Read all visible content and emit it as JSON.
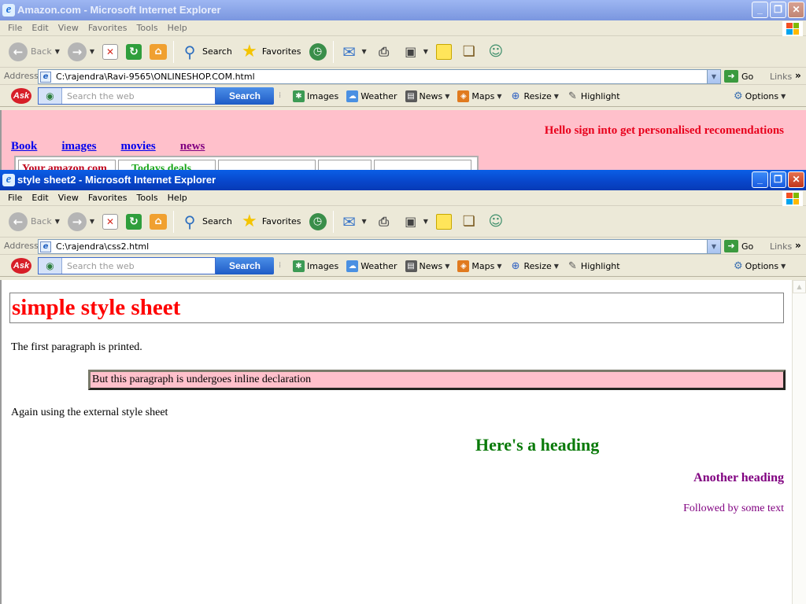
{
  "back_window": {
    "title": "Amazon.com - Microsoft Internet Explorer",
    "menu": [
      "File",
      "Edit",
      "View",
      "Favorites",
      "Tools",
      "Help"
    ],
    "toolbar": {
      "back": "Back",
      "search": "Search",
      "favorites": "Favorites"
    },
    "address_label": "Address",
    "address": "C:\\rajendra\\Ravi-9565\\ONLINESHOP.COM.html",
    "go": "Go",
    "links": "Links",
    "ask": {
      "logo": "Ask",
      "search_placeholder": "Search the web",
      "search_button": "Search",
      "items": [
        "Images",
        "Weather",
        "News",
        "Maps",
        "Resize",
        "Highlight"
      ],
      "options": "Options"
    },
    "page": {
      "greeting": "Hello sign into get personalised recomendations",
      "nav_links": [
        "Book",
        "images",
        "movies",
        "news"
      ],
      "table_cells": [
        "Your amazon.com",
        "Todays deals"
      ]
    }
  },
  "front_window": {
    "title": "style sheet2 - Microsoft Internet Explorer",
    "menu": [
      "File",
      "Edit",
      "View",
      "Favorites",
      "Tools",
      "Help"
    ],
    "toolbar": {
      "back": "Back",
      "search": "Search",
      "favorites": "Favorites"
    },
    "address_label": "Address",
    "address": "C:\\rajendra\\css2.html",
    "go": "Go",
    "links": "Links",
    "ask": {
      "logo": "Ask",
      "search_placeholder": "Search the web",
      "search_button": "Search",
      "items": [
        "Images",
        "Weather",
        "News",
        "Maps",
        "Resize",
        "Highlight"
      ],
      "options": "Options"
    },
    "page": {
      "heading": "simple style sheet",
      "para1": "The first paragraph is printed.",
      "inline_para": "But this paragraph is undergoes inline declaration",
      "para3": "Again using the external style sheet",
      "heading2": "Here's a heading",
      "heading3": "Another heading",
      "follow_text": "Followed by some text"
    }
  },
  "colors": {
    "inactive_title": "#7A96DF",
    "active_title": "#0845C9",
    "page_pink": "#FFC0CB",
    "heading_red": "#FF0000",
    "heading_green": "#0A7A0A",
    "heading_purple": "#800080"
  },
  "icons": [
    "ie-icon",
    "back-icon",
    "forward-icon",
    "stop-icon",
    "refresh-icon",
    "home-icon",
    "search-icon",
    "favorites-star-icon",
    "history-icon",
    "mail-icon",
    "print-icon",
    "edit-icon",
    "note-icon",
    "research-icon",
    "messenger-icon",
    "windows-logo-icon",
    "ask-logo-icon",
    "globe-icon",
    "go-arrow-icon",
    "options-gear-icon"
  ]
}
